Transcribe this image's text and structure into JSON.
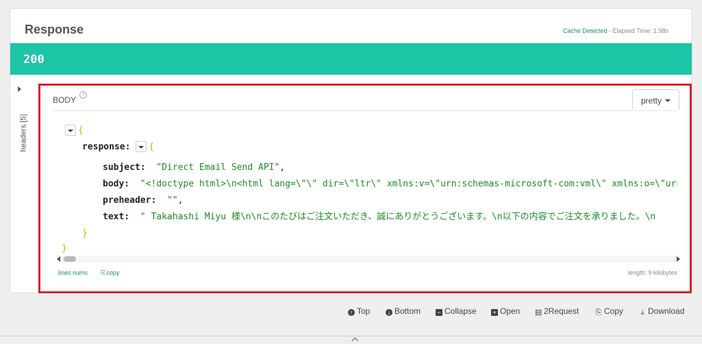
{
  "panel": {
    "title": "Response",
    "cache_detected": "Cache Detected",
    "elapsed": " - Elapsed Time: 1.98s"
  },
  "status": {
    "code": "200",
    "color": "#1bc5a5"
  },
  "headers_tab": {
    "label": "headers",
    "count": "[5]"
  },
  "body_section": {
    "label": "BODY",
    "help_glyph": "?",
    "format_select": "pretty",
    "accent_color": "#d8232a"
  },
  "json_view": {
    "open_brace": "{",
    "close_brace": "}",
    "response_key": "response:",
    "fields": [
      {
        "key": "subject:",
        "value": "\"Direct Email Send API\"",
        "comma": ","
      },
      {
        "key": "body:",
        "value": "\"<!doctype html>\\n<html lang=\\\"\\\" dir=\\\"ltr\\\" xmlns:v=\\\"urn:schemas-microsoft-com:vml\\\" xmlns:o=\\\"urn:s",
        "comma": ""
      },
      {
        "key": "preheader:",
        "value": "\"\"",
        "comma": ","
      },
      {
        "key": "text:",
        "value": "\" Takahashi Miyu 様\\n\\nこのたびはご注文いただき、誠にありがとうございます。\\n以下の内容でご注文を承りました。\\n",
        "comma": ""
      }
    ]
  },
  "footer": {
    "lines_nums": "lines nums",
    "copy": "copy",
    "length": "length: 9 kilobytes"
  },
  "actions": [
    {
      "label": "Top",
      "icon": "arrow-up-circle-icon",
      "glyph": "↑"
    },
    {
      "label": "Bottom",
      "icon": "arrow-down-circle-icon",
      "glyph": "↓"
    },
    {
      "label": "Collapse",
      "icon": "minus-square-icon",
      "glyph": "−"
    },
    {
      "label": "Open",
      "icon": "plus-square-icon",
      "glyph": "+"
    },
    {
      "label": "2Request",
      "icon": "clipboard-icon",
      "glyph": "▤"
    },
    {
      "label": "Copy",
      "icon": "copy-icon",
      "glyph": "⎘"
    },
    {
      "label": "Download",
      "icon": "download-icon",
      "glyph": "⤓"
    }
  ]
}
